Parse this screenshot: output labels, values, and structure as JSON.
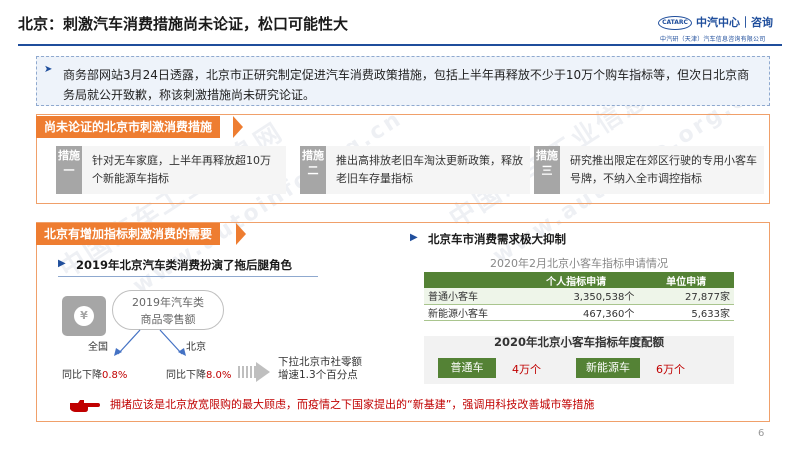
{
  "header": {
    "title": "北京：刺激汽车消费措施尚未论证，松口可能性大",
    "brand_logo": "CATARC",
    "brand_name": "中汽中心｜咨询",
    "brand_sub": "中汽研（天津）汽车信息咨询有限公司"
  },
  "intro": {
    "text": "商务部网站3月24日透露，北京市正研究制定促进汽车消费政策措施，包括上半年再释放不少于10万个购车指标等，但次日北京商务局就公开致歉，称该刺激措施尚未研究论证。"
  },
  "section1": {
    "tag": "尚未论证的北京市刺激消费措施",
    "items": [
      {
        "badge": "措施一",
        "text": "针对无车家庭，上半年再释放超10万个新能源车指标"
      },
      {
        "badge": "措施二",
        "text": "推出高排放老旧车淘汰更新政策，释放老旧车存量指标"
      },
      {
        "badge": "措施三",
        "text": "研究推出限定在郊区行驶的专用小客车号牌，不纳入全市调控指标"
      }
    ]
  },
  "section2": {
    "tag": "北京有增加指标刺激消费的需要",
    "left_head": "2019年北京汽车类消费扮演了拖后腿角色",
    "retail_label_1": "2019年汽车类",
    "retail_label_2": "商品零售额",
    "wallet_symbol": "¥",
    "national_label": "全国",
    "beijing_label": "北京",
    "national_change_prefix": "同比下降",
    "national_change_value": "0.8%",
    "beijing_change_prefix": "同比下降",
    "beijing_change_value": "8.0%",
    "impact_line1": "下拉北京市社零额",
    "impact_line2": "增速1.3个百分点",
    "right_head": "北京车市消费需求极大抑制",
    "table_caption": "2020年2月北京小客车指标申请情况",
    "table_headers": [
      "",
      "个人指标申请",
      "单位申请"
    ],
    "table_rows": [
      {
        "type": "普通小客车",
        "personal": "3,350,538个",
        "unit": "27,877家"
      },
      {
        "type": "新能源小客车",
        "personal": "467,360个",
        "unit": "5,633家"
      }
    ],
    "quota_title": "2020年北京小客车指标年度配额",
    "quota": [
      {
        "label": "普通车",
        "value": "4万个"
      },
      {
        "label": "新能源车",
        "value": "6万个"
      }
    ],
    "bottom_note": "拥堵应该是北京放宽限购的最大顾虑，而疫情之下国家提出的“新基建”，强调用科技改善城市等措施"
  },
  "page_number": "6",
  "watermark": {
    "line1": "中国汽车工业信息网",
    "line2": "www.autoinfo.org.cn"
  }
}
